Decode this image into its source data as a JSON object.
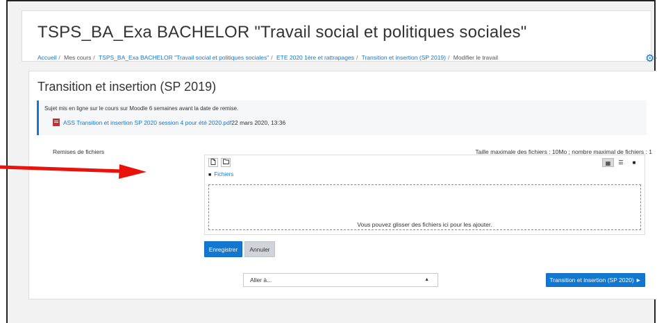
{
  "course_title": "TSPS_BA_Exa BACHELOR \"Travail social et politiques sociales\"",
  "breadcrumb": [
    {
      "label": "Accueil",
      "link": true
    },
    {
      "label": "Mes cours",
      "link": false
    },
    {
      "label": "TSPS_BA_Exa BACHELOR \"Travail social et politiques sociales\"",
      "link": true
    },
    {
      "label": "ETE 2020 1ère et rattrapages",
      "link": true
    },
    {
      "label": "Transition et insertion (SP 2019)",
      "link": true
    },
    {
      "label": "Modifier le travail",
      "link": false
    }
  ],
  "breadcrumb_separator": "/",
  "settings_icon": "gear-icon",
  "assignment": {
    "title": "Transition et insertion (SP 2019)",
    "intro_text": "Sujet mis en ligne sur le cours sur Moodle 6 semaines avant la date de remise.",
    "attachment_name": "ASS Transition et insertion SP 2020 session 4 pour été 2020.pdf",
    "attachment_date": "22 mars 2020, 13:36"
  },
  "form": {
    "field_label": "Remises de fichiers",
    "max_size_text": "Taille maximale des fichiers : 10Mo ; nombre maximal de fichiers : 1",
    "path_label": "Fichiers",
    "dropzone_text": "Vous pouvez glisser des fichiers ici pour les ajouter.",
    "save_label": "Enregistrer",
    "cancel_label": "Annuler"
  },
  "navigation": {
    "jump_placeholder": "Aller à...",
    "next_label": "Transition et insertion (SP 2020) ►"
  },
  "colors": {
    "accent": "#1177d1",
    "annotation_arrow": "#e8140c"
  }
}
